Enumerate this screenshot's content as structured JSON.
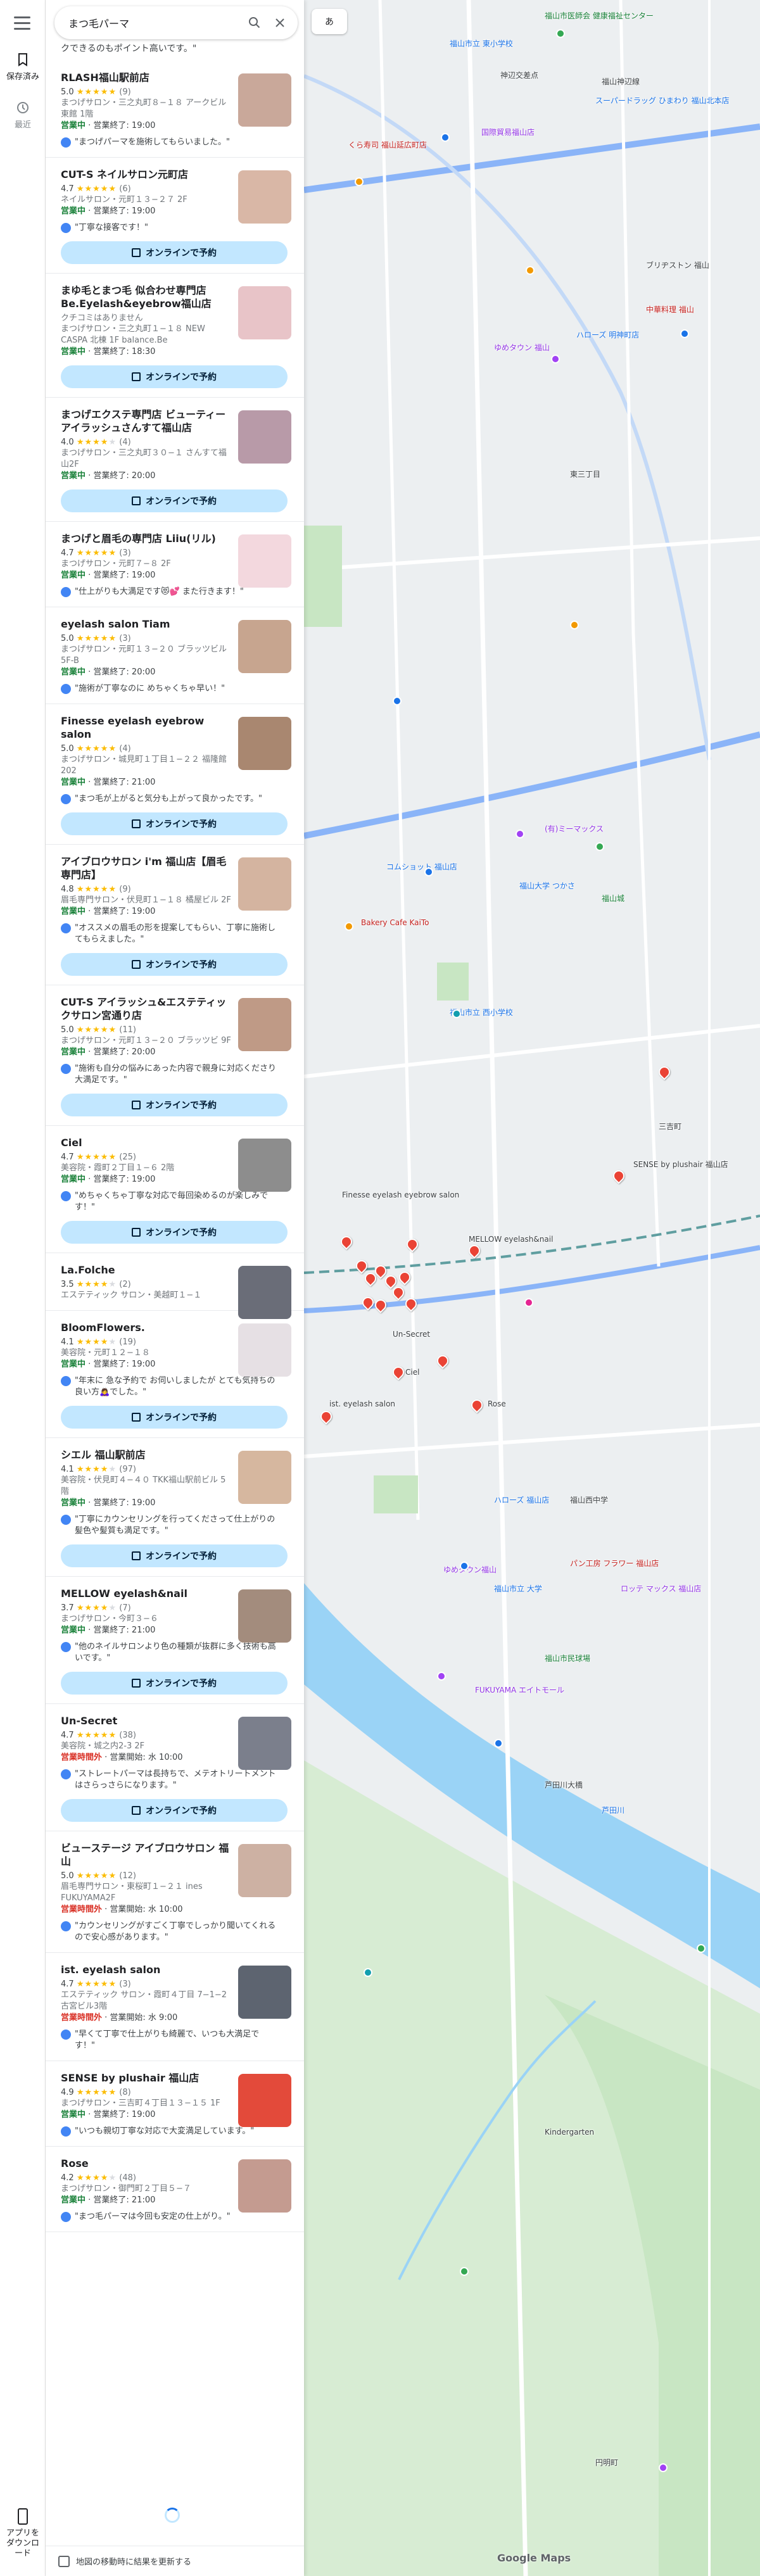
{
  "rail": {
    "saved_label": "保存済み",
    "recent_label": "最近",
    "get_app_label": "アプリをダウンロード"
  },
  "search": {
    "query": "まつ毛パーマ"
  },
  "list_top_text": "クできるのもポイント高いです。\"",
  "book_label": "オンラインで予約",
  "results": [
    {
      "name": "RLASH福山駅前店",
      "rating": "5.0",
      "reviews": "(9)",
      "category": "まつげサロン・三之丸町８−１８ アークビル東館 1階",
      "status": "営業中",
      "status_rest": " · 営業終了: 19:00",
      "review": "\"まつげパーマを施術してもらいました。\"",
      "book": false,
      "thumb": "#c9a89a"
    },
    {
      "name": "CUT-S ネイルサロン元町店",
      "rating": "4.7",
      "reviews": "(6)",
      "category": "ネイルサロン・元町１３−２７ 2F",
      "status": "営業中",
      "status_rest": " · 営業終了: 19:00",
      "review": "\"丁寧な接客です！\"",
      "book": true,
      "thumb": "#d9b7a6"
    },
    {
      "name": "まゆ毛とまつ毛 似合わせ専門店 Be.Eyelash&eyebrow福山店",
      "rating": "クチコミはありません",
      "reviews": "",
      "category": "まつげサロン・三之丸町１−１８ NEW CASPA 北棟 1F balance.Be",
      "status": "営業中",
      "status_rest": " · 営業終了: 18:30",
      "review": "",
      "book": true,
      "thumb": "#e8c4c8"
    },
    {
      "name": "まつげエクステ専門店 ビューティーアイラッシュさんすて福山店",
      "rating": "4.0",
      "reviews": "(4)",
      "category": "まつげサロン・三之丸町３０−１ さんすて福山2F",
      "status": "営業中",
      "status_rest": " · 営業終了: 20:00",
      "review": "",
      "book": true,
      "thumb": "#b89aa8"
    },
    {
      "name": "まつげと眉毛の専門店 Liiu(リル)",
      "rating": "4.7",
      "reviews": "(3)",
      "category": "まつげサロン・元町７−８ 2F",
      "status": "営業中",
      "status_rest": " · 営業終了: 19:00",
      "review": "\"仕上がりも大満足です😻💕 また行きます！\"",
      "book": false,
      "thumb": "#f3d8de"
    },
    {
      "name": "eyelash salon Tiam",
      "rating": "5.0",
      "reviews": "(3)",
      "category": "まつげサロン・元町１３−２０ ブラッツビル 5F-B",
      "status": "営業中",
      "status_rest": " · 営業終了: 20:00",
      "review": "\"施術が丁寧なのに めちゃくちゃ早い！\"",
      "book": false,
      "thumb": "#c7a58f"
    },
    {
      "name": "Finesse eyelash eyebrow salon",
      "rating": "5.0",
      "reviews": "(4)",
      "category": "まつげサロン・城見町１丁目１−２２ 福隆館202",
      "status": "営業中",
      "status_rest": " · 営業終了: 21:00",
      "review": "\"まつ毛が上がると気分も上がって良かったです。\"",
      "book": true,
      "thumb": "#a98770"
    },
    {
      "name": "アイブロウサロン i'm 福山店【眉毛専門店】",
      "rating": "4.8",
      "reviews": "(9)",
      "category": "眉毛専門サロン・伏見町１−１８ 橘屋ビル 2F",
      "status": "営業中",
      "status_rest": " · 営業終了: 19:00",
      "review": "\"オススメの眉毛の形を提案してもらい、丁寧に施術してもらえました。\"",
      "book": true,
      "thumb": "#d4b4a0"
    },
    {
      "name": "CUT-S アイラッシュ&エステティックサロン宮通り店",
      "rating": "5.0",
      "reviews": "(11)",
      "category": "まつげサロン・元町１３−２０ ブラッツビ 9F",
      "status": "営業中",
      "status_rest": " · 営業終了: 20:00",
      "review": "\"施術も自分の悩みにあった内容で親身に対応くださり大満足です。\"",
      "book": true,
      "thumb": "#bf9a86"
    },
    {
      "name": "Ciel",
      "rating": "4.7",
      "reviews": "(25)",
      "category": "美容院・霞町２丁目１−６ 2階",
      "status": "営業中",
      "status_rest": " · 営業終了: 19:00",
      "review": "\"めちゃくちゃ丁寧な対応で毎回染めるのが楽しみです！\"",
      "book": true,
      "thumb": "#8d8d8d"
    },
    {
      "name": "La.Folche",
      "rating": "3.5",
      "reviews": "(2)",
      "category": "エステティック サロン・美越町１−１",
      "status": "",
      "status_rest": "",
      "review": "",
      "book": false,
      "thumb": "#6a6d78"
    },
    {
      "name": "BloomFlowers.",
      "rating": "4.1",
      "reviews": "(19)",
      "category": "美容院・元町１２−１８",
      "status": "営業中",
      "status_rest": " · 営業終了: 19:00",
      "review": "\"年末に 急な予約で お伺いしましたが とても気持ちの良い方🙇‍♀️でした。\"",
      "book": true,
      "thumb": "#e6e0e4"
    },
    {
      "name": "シエル 福山駅前店",
      "rating": "4.1",
      "reviews": "(97)",
      "category": "美容院・伏見町４−４０ TKK福山駅前ビル 5階",
      "status": "営業中",
      "status_rest": " · 営業終了: 19:00",
      "review": "\"丁寧にカウンセリングを行ってくださって仕上がりの髪色や髪質も満足です。\"",
      "book": true,
      "thumb": "#d6b79f"
    },
    {
      "name": "MELLOW eyelash&nail",
      "rating": "3.7",
      "reviews": "(7)",
      "category": "まつげサロン・今町３−６",
      "status": "営業中",
      "status_rest": " · 営業終了: 21:00",
      "review": "\"他のネイルサロンより色の種類が抜群に多く技術も高いです。\"",
      "book": true,
      "thumb": "#a38c7d"
    },
    {
      "name": "Un-Secret",
      "rating": "4.7",
      "reviews": "(38)",
      "category": "美容院・城之内2-3 2F",
      "status": "営業時間外",
      "status_rest": " · 営業開始: 水 10:00",
      "review": "\"ストレートパーマは長持ちで、メテオトリートメントはさらっさらになります。\"",
      "book": true,
      "thumb": "#7b7f8c"
    },
    {
      "name": "ビューステージ アイブロウサロン 福山",
      "rating": "5.0",
      "reviews": "(12)",
      "category": "眉毛専門サロン・東桜町１−２１ ines FUKUYAMA2F",
      "status": "営業時間外",
      "status_rest": " · 営業開始: 水 10:00",
      "review": "\"カウンセリングがすごく丁寧でしっかり聞いてくれるので安心感があります。\"",
      "book": false,
      "thumb": "#cdb1a3"
    },
    {
      "name": "ist. eyelash salon",
      "rating": "4.7",
      "reviews": "(3)",
      "category": "エステティック サロン・霞町４丁目 7−1−2 古宮ビル3階",
      "status": "営業時間外",
      "status_rest": " · 営業開始: 水 9:00",
      "review": "\"早くて丁寧で仕上がりも綺麗で、いつも大満足です！\"",
      "book": false,
      "thumb": "#5d6470"
    },
    {
      "name": "SENSE by plushair 福山店",
      "rating": "4.9",
      "reviews": "(8)",
      "category": "まつげサロン・三吉町４丁目１３−１５ 1F",
      "status": "営業中",
      "status_rest": " · 営業終了: 19:00",
      "review": "\"いつも親切丁寧な対応で大変満足しています。\"",
      "book": false,
      "thumb": "#e34a3a"
    },
    {
      "name": "Rose",
      "rating": "4.2",
      "reviews": "(48)",
      "category": "まつげサロン・御門町２丁目５−７",
      "status": "営業中",
      "status_rest": " · 営業終了: 21:00",
      "review": "\"まつ毛パーマは今回も安定の仕上がり。\"",
      "book": false,
      "thumb": "#c49b90"
    }
  ],
  "footer_checkbox_label": "地図の移動時に結果を更新する",
  "map": {
    "lang_chip": "あ",
    "attribution": "Google Maps",
    "labels": [
      {
        "t": "福山市医師会 健康福祉センター",
        "c": "green"
      },
      {
        "t": "福山市立 東小学校",
        "c": "blue"
      },
      {
        "t": "神辺交差点",
        "c": ""
      },
      {
        "t": "福山神辺線",
        "c": ""
      },
      {
        "t": "くら寿司 福山延広町店",
        "c": "orange"
      },
      {
        "t": "スーパードラッグ ひまわり 福山北本店",
        "c": "blue"
      },
      {
        "t": "国際貿易福山店",
        "c": "purple"
      },
      {
        "t": "ゆめタウン 福山",
        "c": "purple"
      },
      {
        "t": "中華料理 福山",
        "c": "orange"
      },
      {
        "t": "ハローズ 明神町店",
        "c": "blue"
      },
      {
        "t": "ブリヂストン 福山",
        "c": ""
      },
      {
        "t": "東三丁目",
        "c": ""
      },
      {
        "t": "コムショット 福山店",
        "c": "blue"
      },
      {
        "t": "(有)ミーマックス",
        "c": "purple"
      },
      {
        "t": "福山大学 つかさ",
        "c": "blue"
      },
      {
        "t": "Bakery Cafe KaiTo",
        "c": "orange"
      },
      {
        "t": "福山市立 西小学校",
        "c": "blue"
      },
      {
        "t": "福山城",
        "c": "green"
      },
      {
        "t": "三吉町",
        "c": ""
      },
      {
        "t": "SENSE by plushair 福山店",
        "c": ""
      },
      {
        "t": "Finesse eyelash eyebrow salon",
        "c": ""
      },
      {
        "t": "MELLOW eyelash&nail",
        "c": ""
      },
      {
        "t": "Un-Secret",
        "c": ""
      },
      {
        "t": "Ciel",
        "c": ""
      },
      {
        "t": "ist. eyelash salon",
        "c": ""
      },
      {
        "t": "Rose",
        "c": ""
      },
      {
        "t": "ハローズ 福山店",
        "c": "blue"
      },
      {
        "t": "FUKUYAMA エイトモール",
        "c": "purple"
      },
      {
        "t": "福山市民球場",
        "c": "green"
      },
      {
        "t": "芦田川",
        "c": "blue"
      },
      {
        "t": "ゆめタウン福山",
        "c": "purple"
      },
      {
        "t": "福山西中学",
        "c": ""
      },
      {
        "t": "福山市立 大学",
        "c": "blue"
      },
      {
        "t": "ロッテ マックス 福山店",
        "c": "purple"
      },
      {
        "t": "パン工房 フラワー 福山店",
        "c": "orange"
      },
      {
        "t": "芦田川大橋",
        "c": ""
      },
      {
        "t": "Kindergarten",
        "c": ""
      },
      {
        "t": "円明町",
        "c": ""
      }
    ]
  }
}
